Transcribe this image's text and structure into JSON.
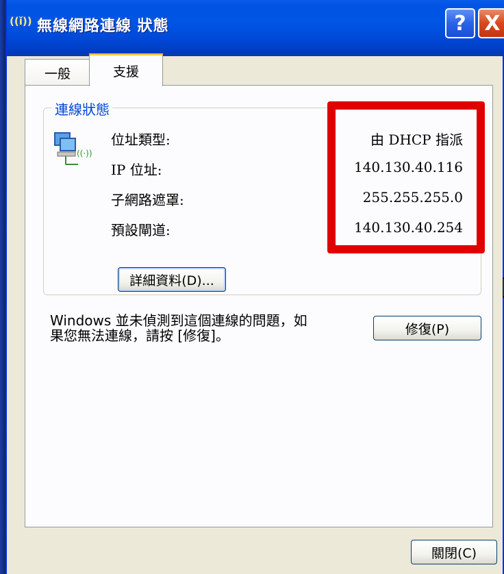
{
  "window": {
    "title": "無線網路連線 狀態",
    "title_icon": "wireless-icon",
    "help_label": "?",
    "close_label": "X"
  },
  "tabs": [
    {
      "label": "一般",
      "active": false
    },
    {
      "label": "支援",
      "active": true
    }
  ],
  "connection_status": {
    "group_label": "連線狀態",
    "fields": [
      {
        "label": "位址類型:",
        "value": "由 DHCP 指派"
      },
      {
        "label": "IP 位址:",
        "value": "140.130.40.116"
      },
      {
        "label": "子網路遮罩:",
        "value": "255.255.255.0"
      },
      {
        "label": "預設閘道:",
        "value": "140.130.40.254"
      }
    ],
    "details_button": "詳細資料(D)..."
  },
  "repair": {
    "message_line1": "Windows 並未偵測到這個連線的問題，如",
    "message_line2": "果您無法連線，請按 [修復]。",
    "button": "修復(P)"
  },
  "footer": {
    "close_button": "關閉(C)"
  },
  "colors": {
    "titlebar": "#0054e3",
    "group_label": "#0046d5",
    "highlight": "#e00000",
    "dialog_bg": "#ece9d8"
  }
}
